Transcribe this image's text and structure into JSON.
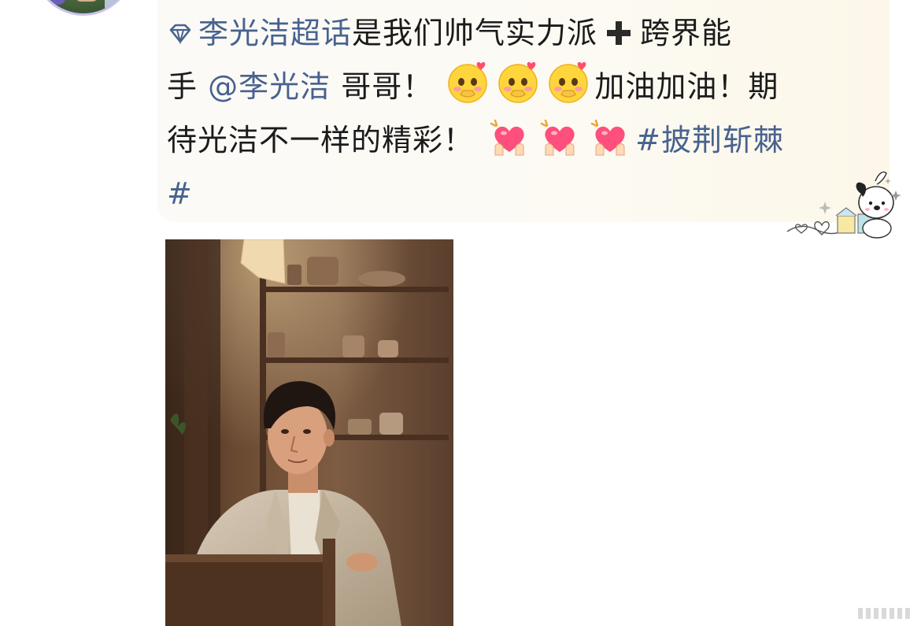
{
  "post": {
    "comment": {
      "topic_link": "李光洁超话",
      "text_part1": "是我们帅气实力派",
      "text_part2": "跨界能",
      "line2_start": "手",
      "mention_link": "@李光洁",
      "text_part3": "哥哥！",
      "text_part4": "加油加油！期",
      "line3_start": "待光洁不一样的精彩！",
      "hashtag_link": "#披荆斩棘",
      "hashtag_end": "#"
    },
    "colors": {
      "link": "#48628f",
      "text": "#1b1b1b",
      "bubble_background": "#fcfaf3",
      "avatar_border": "#c9c2ee"
    },
    "icons": {
      "topic": "diamond-icon",
      "plus": "plus-icon",
      "face_emoji": "blushing-face-emoji",
      "heart_emoji": "heart-hands-emoji",
      "decoration": "pochacco-sticker"
    }
  }
}
